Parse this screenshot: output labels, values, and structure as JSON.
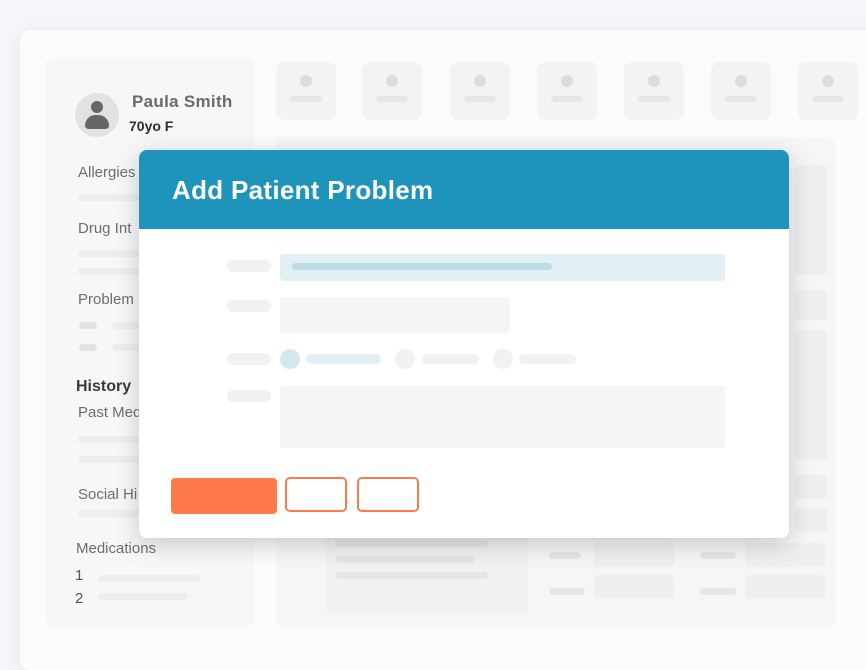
{
  "patient": {
    "name": "Paula Smith",
    "meta": "70yo F"
  },
  "sidebar": {
    "allergies": "Allergies",
    "drug_interactions": "Drug Int",
    "problems": "Problem",
    "history": "History",
    "past_medical": "Past Med",
    "social_history": "Social Hi",
    "medications": "Medications",
    "medication_numbers": [
      "1",
      "2"
    ]
  },
  "modal": {
    "title": "Add Patient Problem"
  },
  "colors": {
    "header": "#1e93bc",
    "accent": "#ff7a4a"
  }
}
